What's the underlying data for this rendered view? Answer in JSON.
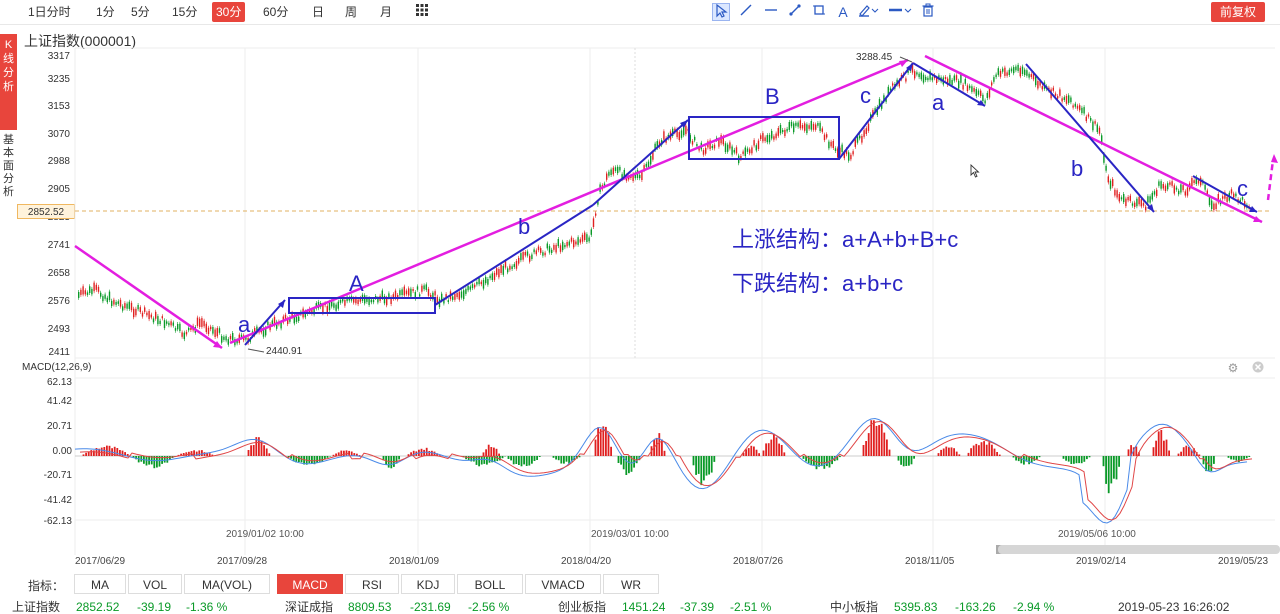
{
  "toolbar": {
    "periods": [
      "1日分时",
      "1分",
      "5分",
      "15分",
      "30分",
      "60分",
      "日",
      "周",
      "月"
    ],
    "active_period": "30分",
    "grid_icon": "grid-icon",
    "tools": [
      "cursor-icon",
      "line-icon",
      "horizontal-line-icon",
      "segment-icon",
      "rectangle-icon",
      "text-icon",
      "brush-icon",
      "dash-icon",
      "trash-icon"
    ],
    "text_tool": "A",
    "restore_button": "前复权"
  },
  "side_tabs": {
    "k_line": [
      "K",
      "线",
      "分",
      "析"
    ],
    "fundamental": [
      "基",
      "本",
      "面",
      "分",
      "析"
    ]
  },
  "chart": {
    "title": "上证指数(000001)",
    "current_price_box": "2852.52",
    "high_label": "3288.45",
    "low_label": "2440.91",
    "price_ticks": [
      "3317",
      "3235",
      "3153",
      "3070",
      "2988",
      "2905",
      "2823",
      "2741",
      "2658",
      "2576",
      "2493",
      "2411"
    ],
    "macd_label": "MACD(12,26,9)",
    "macd_ticks": [
      "62.13",
      "41.42",
      "20.71",
      "0.00",
      "-20.71",
      "-41.42",
      "-62.13"
    ],
    "macd_dates": [
      "2019/01/02 10:00",
      "2019/03/01 10:00",
      "2019/05/06 10:00"
    ],
    "x_dates": [
      "2017/06/29",
      "2017/09/28",
      "2018/01/09",
      "2018/04/20",
      "2018/07/26",
      "2018/11/05",
      "2019/02/14",
      "2019/05/23"
    ],
    "colors": {
      "up": "#e02020",
      "down": "#0a9a28",
      "trend_pink": "#e31ee0",
      "wave_blue": "#2a25c4"
    }
  },
  "annotations": {
    "labels": [
      "a",
      "A",
      "b",
      "B",
      "c",
      "a",
      "b",
      "c"
    ],
    "rise_structure": "上涨结构：a+A+b+B+c",
    "fall_structure": "下跌结构：a+b+c"
  },
  "indicators": {
    "label": "指标：",
    "items": [
      "MA",
      "VOL",
      "MA(VOL)",
      "MACD",
      "RSI",
      "KDJ",
      "BOLL",
      "VMACD",
      "WR"
    ],
    "active": "MACD"
  },
  "status": {
    "sh": {
      "name": "上证指数",
      "value": "2852.52",
      "change": "-39.19",
      "pct": "-1.36 %"
    },
    "sz": {
      "name": "深证成指",
      "value": "8809.53",
      "change": "-231.69",
      "pct": "-2.56 %"
    },
    "cy": {
      "name": "创业板指",
      "value": "1451.24",
      "change": "-37.39",
      "pct": "-2.51 %"
    },
    "zx": {
      "name": "中小板指",
      "value": "5395.83",
      "change": "-163.26",
      "pct": "-2.94 %"
    },
    "time": "2019-05-23 16:26:02"
  }
}
